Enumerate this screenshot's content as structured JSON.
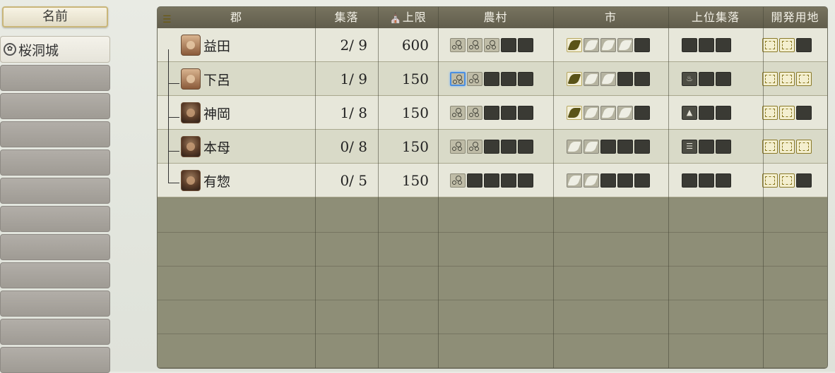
{
  "sidebar": {
    "header": "名前",
    "castle": {
      "label": "桜洞城",
      "icon": "mon-crest-icon"
    }
  },
  "table": {
    "columns": {
      "gun": "郡",
      "settlements": "集落",
      "limit": "上限",
      "farm": "農村",
      "market": "市",
      "upper": "上位集落",
      "dev": "開発用地"
    },
    "rows": [
      {
        "gun": "益田",
        "settlements": "2/ 9",
        "limit": "600",
        "farm": {
          "built": 3,
          "total": 5,
          "selected": -1
        },
        "market": {
          "filled": 1,
          "light": 3,
          "total": 5
        },
        "upper": {
          "icon": "",
          "total": 3
        },
        "dev": {
          "open": 2,
          "total": 3
        }
      },
      {
        "gun": "下呂",
        "settlements": "1/ 9",
        "limit": "150",
        "farm": {
          "built": 2,
          "total": 5,
          "selected": 0
        },
        "market": {
          "filled": 1,
          "light": 2,
          "total": 5
        },
        "upper": {
          "icon": "hot-spring-icon",
          "total": 3
        },
        "dev": {
          "open": 3,
          "total": 3
        }
      },
      {
        "gun": "神岡",
        "settlements": "1/ 8",
        "limit": "150",
        "farm": {
          "built": 2,
          "total": 5,
          "selected": -1
        },
        "market": {
          "filled": 1,
          "light": 3,
          "total": 5
        },
        "upper": {
          "icon": "mine-icon",
          "total": 3
        },
        "dev": {
          "open": 2,
          "total": 3
        }
      },
      {
        "gun": "本母",
        "settlements": "0/ 8",
        "limit": "150",
        "farm": {
          "built": 2,
          "total": 5,
          "selected": -1
        },
        "market": {
          "filled": 0,
          "light": 2,
          "total": 5
        },
        "upper": {
          "icon": "temple-icon",
          "total": 3
        },
        "dev": {
          "open": 3,
          "total": 3
        }
      },
      {
        "gun": "有惣",
        "settlements": "0/ 5",
        "limit": "150",
        "farm": {
          "built": 1,
          "total": 5,
          "selected": -1
        },
        "market": {
          "filled": 0,
          "light": 2,
          "total": 5
        },
        "upper": {
          "icon": "",
          "total": 3
        },
        "dev": {
          "open": 2,
          "total": 3
        }
      }
    ]
  }
}
